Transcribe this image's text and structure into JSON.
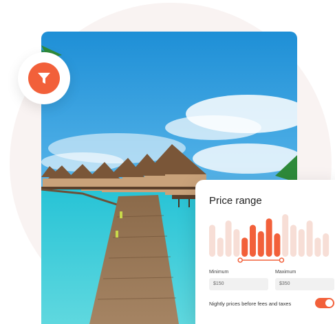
{
  "price_filter": {
    "title": "Price range",
    "minimum_label": "Minimum",
    "minimum_value": "$150",
    "maximum_label": "Maximum",
    "maximum_value": "$350",
    "note": "Nightly prices before fees and taxes",
    "toggle_on": true,
    "histogram_levels": [
      0.75,
      0.45,
      0.85,
      0.65,
      0.45,
      0.75,
      0.6,
      0.9,
      0.55,
      1.0,
      0.75,
      0.65,
      0.85,
      0.45,
      0.55
    ],
    "selected_range": [
      4,
      8
    ],
    "colors": {
      "accent": "#f2603a",
      "bar_inactive": "#f7ded6"
    }
  },
  "icons": {
    "filter": "funnel-icon"
  }
}
